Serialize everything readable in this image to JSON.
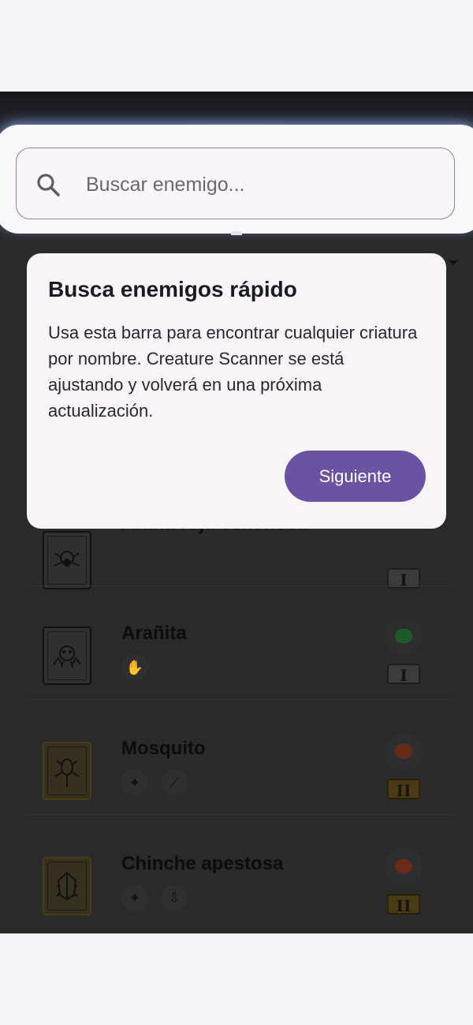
{
  "search": {
    "placeholder": "Buscar enemigo..."
  },
  "enemies": [
    {
      "name": "Araña roja venenosa",
      "tier": "I",
      "creature_color": "#5a5a5a"
    },
    {
      "name": "Arañita",
      "tier": "I",
      "creature_color": "#1f5a2b"
    },
    {
      "name": "Mosquito",
      "tier": "II",
      "creature_color": "#6a2a1a"
    },
    {
      "name": "Chinche apestosa",
      "tier": "II",
      "creature_color": "#6a2a1a"
    }
  ],
  "tooltip": {
    "title": "Busca enemigos rápido",
    "body": "Usa esta barra para encontrar cualquier criatura por nombre. Creature Scanner se está ajustando y volverá en una próxima actualización.",
    "next_label": "Siguiente"
  },
  "colors": {
    "accent": "#6b53a3",
    "tier_bronze": "#4a3a15"
  }
}
